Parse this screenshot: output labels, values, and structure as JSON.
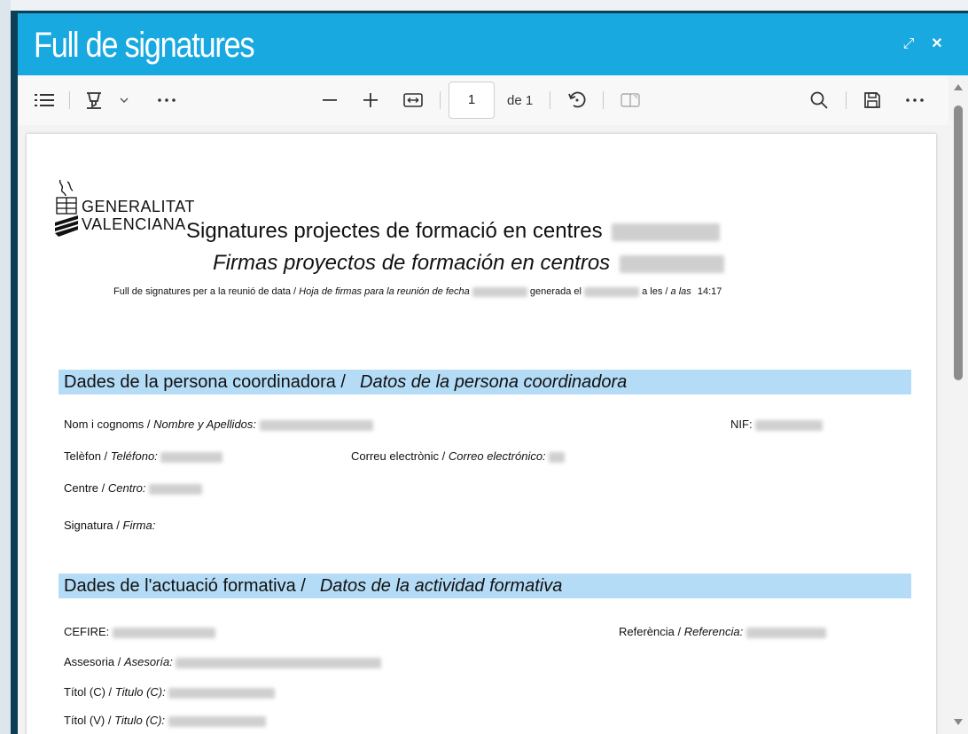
{
  "window": {
    "title": "Full de signatures",
    "expand_glyph": "⤢",
    "close_glyph": "✕"
  },
  "toolbar": {
    "page_number": "1",
    "page_of": "de 1",
    "icons": [
      "list-icon",
      "highlight-icon",
      "chevron-down-icon",
      "more-icon",
      "zoom-out-icon",
      "zoom-in-icon",
      "fit-width-icon",
      "rotate-icon",
      "two-page-icon",
      "search-icon",
      "save-icon",
      "more-icon"
    ]
  },
  "document": {
    "logo_line1": "GENERALITAT",
    "logo_line2": "VALENCIANA",
    "title_va": "Signatures projectes de formació en centres",
    "title_es": "Firmas proyectos de formación en centros",
    "meta_prefix": "Full de signatures per a la reunió de data /",
    "meta_prefix_es": "Hoja de firmas para la reunión de fecha",
    "meta_generated": "generada el",
    "meta_at": "a les /",
    "meta_at_es": "a las",
    "meta_time": "14:17",
    "section1": {
      "title_va": "Dades de la persona coordinadora /",
      "title_es": "Datos de la persona coordinadora",
      "name_label": "Nom i cognoms /",
      "name_label_es": "Nombre y Apellidos:",
      "nif_label": "NIF:",
      "phone_label": "Telèfon /",
      "phone_label_es": "Teléfono:",
      "email_label": "Correu electrònic /",
      "email_label_es": "Correo electrónico:",
      "centre_label": "Centre /",
      "centre_label_es": "Centro:",
      "signature_label": "Signatura /",
      "signature_label_es": "Firma:"
    },
    "section2": {
      "title_va": "Dades de l'actuació formativa /",
      "title_es": "Datos de la actividad formativa",
      "cefire_label": "CEFIRE:",
      "ref_label": "Referència /",
      "ref_label_es": "Referencia:",
      "advisory_label": "Assesoria /",
      "advisory_label_es": "Asesoría:",
      "title_c_label": "Títol (C) /",
      "title_c_label_es": "Titulo (C):",
      "title_v_label": "Títol (V) /",
      "title_v_label_es": "Titulo (C):"
    }
  }
}
